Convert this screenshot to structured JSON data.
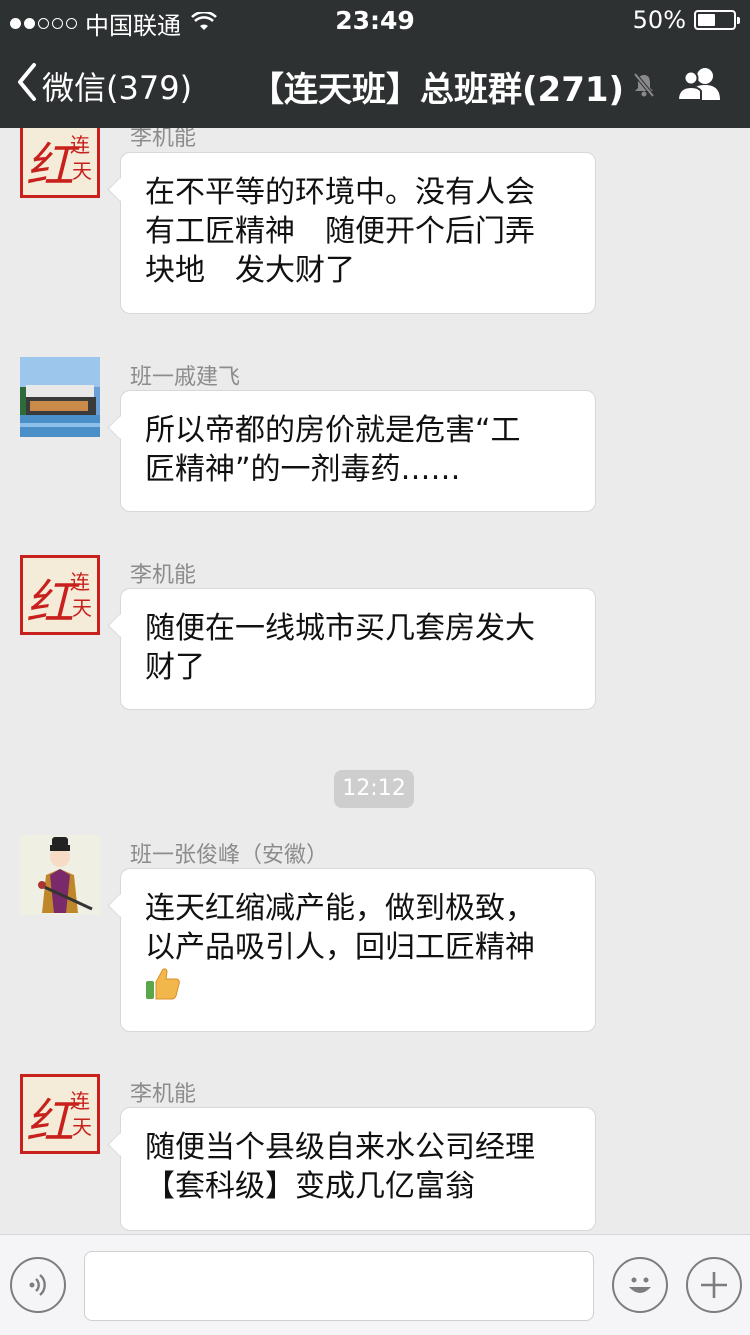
{
  "status_bar": {
    "carrier": "中国联通",
    "time": "23:49",
    "battery": "50%",
    "battery_level": 0.5,
    "signal_bars": 2
  },
  "nav": {
    "back_label": "微信(379)",
    "title": "【连天班】总班群(271)"
  },
  "messages": [
    {
      "sender": "李机能",
      "avatar": "hong-calligraphy-avatar",
      "lines": [
        "在不平等的环境中。没有人会",
        "有工匠精神　随便开个后门弄",
        "块地　发大财了"
      ]
    },
    {
      "sender": "班一戚建飞",
      "avatar": "house-photo-avatar",
      "lines": [
        "所以帝都的房价就是危害“工",
        "匠精神”的一剂毒药……"
      ]
    },
    {
      "sender": "李机能",
      "avatar": "hong-calligraphy-avatar",
      "lines": [
        "随便在一线城市买几套房发大",
        "财了"
      ]
    },
    {
      "sender": "班一张俊峰（安徽）",
      "avatar": "cartoon-figure-avatar",
      "lines": [
        "连天红缩减产能，做到极致，",
        "以产品吸引人，回归工匠精神"
      ],
      "emoji": "thumbs-up"
    },
    {
      "sender": "李机能",
      "avatar": "hong-calligraphy-avatar",
      "lines": [
        "随便当个县级自来水公司经理",
        "【套科级】变成几亿富翁"
      ]
    }
  ],
  "timestamp": "12:12",
  "avatar_text": {
    "hong": "红",
    "lian": "连",
    "tian": "天"
  },
  "icons": [
    "wifi-icon",
    "back-chevron-icon",
    "mute-bell-icon",
    "members-icon",
    "voice-icon",
    "emoji-icon",
    "plus-icon",
    "thumbs-up-icon"
  ]
}
